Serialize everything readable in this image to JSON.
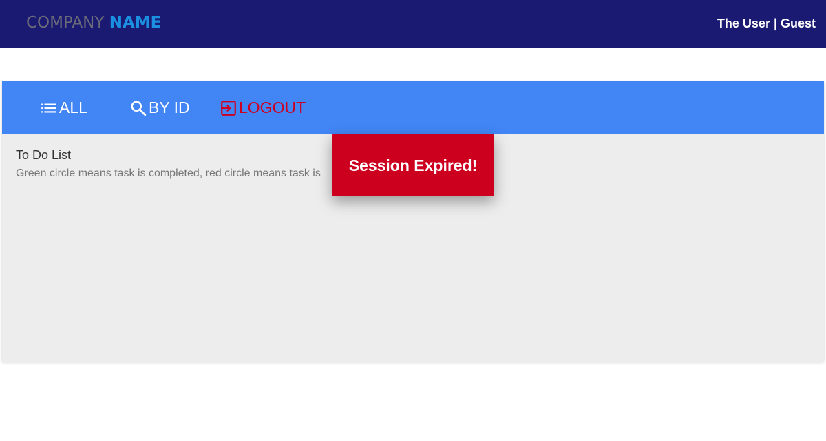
{
  "header": {
    "brand_part1": "COMPANY",
    "brand_part2": "NAME",
    "user_label": "The User | Guest"
  },
  "nav": {
    "all_label": "ALL",
    "all_icon": "list-icon",
    "byid_label": "BY ID",
    "byid_icon": "search-icon",
    "logout_label": "LOGOUT",
    "logout_icon": "logout-icon"
  },
  "content": {
    "title": "To Do List",
    "subtitle": "Green circle means task is completed, red circle means task is"
  },
  "toast": {
    "message": "Session Expired!"
  },
  "colors": {
    "topbar": "#1a1a73",
    "navbar": "#4285f4",
    "logout": "#cc0022",
    "toast": "#cc001e",
    "content_bg": "#ededed"
  }
}
